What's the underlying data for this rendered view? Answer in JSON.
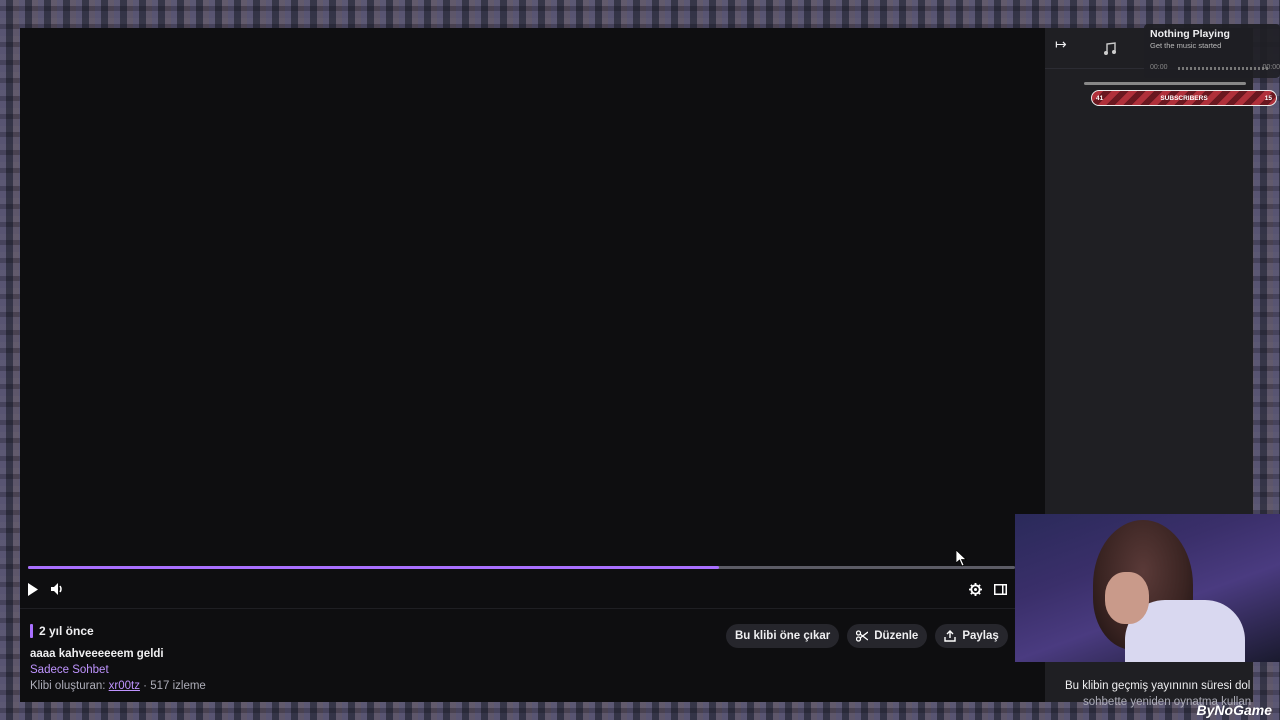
{
  "clip": {
    "age": "2 yıl önce",
    "title": "aaaa kahveeeeeem geldi",
    "category": "Sadece Sohbet",
    "creator_prefix": "Klibi oluşturan:",
    "creator": "xr00tz",
    "views": "517 izleme",
    "progress": 0.7
  },
  "actions": {
    "feature": "Bu klibi öne çıkar",
    "edit": "Düzenle",
    "share": "Paylaş"
  },
  "side_panel": {
    "notice": "Bu klibin geçmiş yayınının süresi dol",
    "notice2": "sohbette yeniden oynatma kullan"
  },
  "music_widget": {
    "title": "Nothing Playing",
    "subtitle": "Get the music started",
    "time_start": "00:00",
    "time_end": "00:00"
  },
  "subs_bar": {
    "left": "41",
    "label": "SUBSCRIBERS",
    "right": "15"
  },
  "watermark": "ByNoGame",
  "colors": {
    "accent": "#a970ff"
  }
}
